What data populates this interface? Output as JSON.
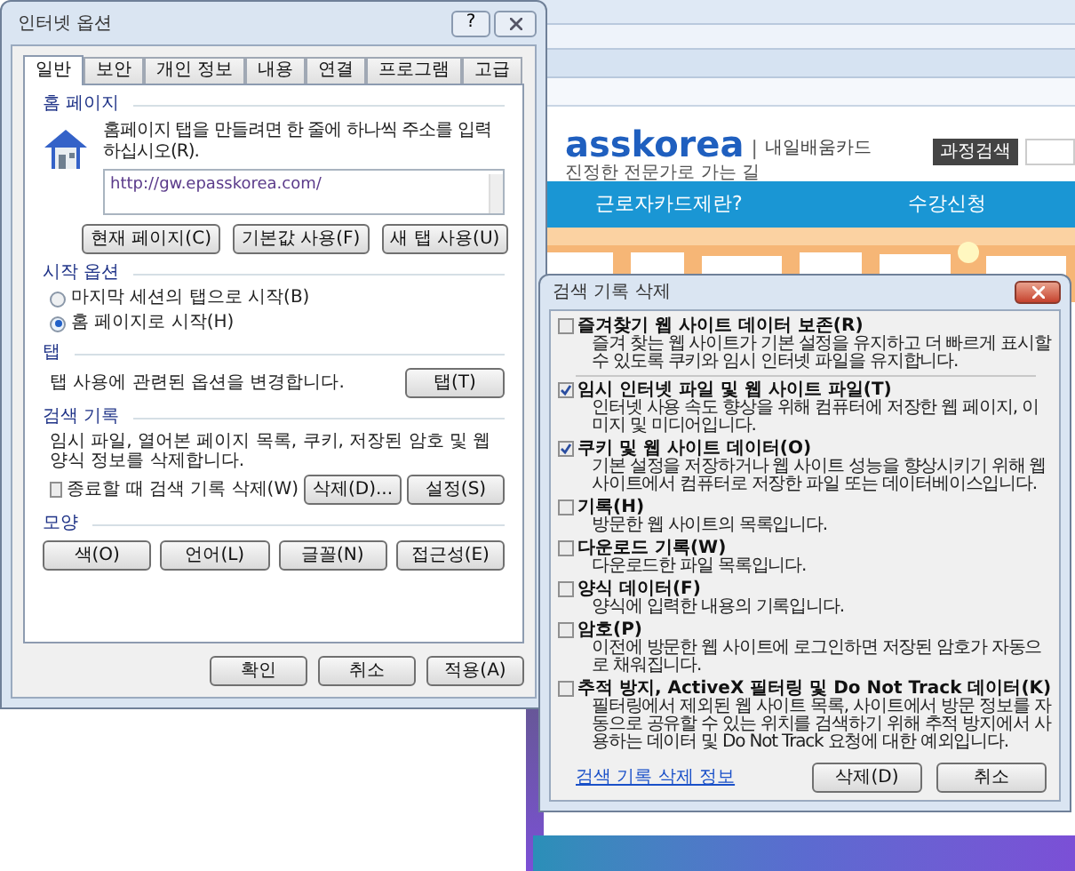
{
  "background_page": {
    "logo": "asskorea",
    "logo_divider": "|",
    "logo_caption": "내일배움카드",
    "tagline": "진정한 전문가로 가는 길",
    "search_button": "과정검색",
    "nav": [
      "근로자카드제란?",
      "수강신청"
    ],
    "banner": {
      "kind": "picture"
    }
  },
  "internet_options": {
    "title": "인터넷 옵션",
    "help_button": "?",
    "tabs": [
      {
        "label": "일반",
        "selected": true
      },
      {
        "label": "보안",
        "selected": false
      },
      {
        "label": "개인 정보",
        "selected": false
      },
      {
        "label": "내용",
        "selected": false
      },
      {
        "label": "연결",
        "selected": false
      },
      {
        "label": "프로그램",
        "selected": false
      },
      {
        "label": "고급",
        "selected": false
      }
    ],
    "home_page": {
      "heading": "홈 페이지",
      "description": "홈페이지 탭을 만들려면 한 줄에 하나씩 주소를 입력하십시오(R).",
      "url": "http://gw.epasskorea.com/",
      "buttons": [
        "현재 페이지(C)",
        "기본값 사용(F)",
        "새 탭 사용(U)"
      ]
    },
    "startup": {
      "heading": "시작 옵션",
      "options": [
        {
          "label": "마지막 세션의 탭으로 시작(B)",
          "selected": false
        },
        {
          "label": "홈 페이지로 시작(H)",
          "selected": true
        }
      ]
    },
    "tabs_section": {
      "heading": "탭",
      "description": "탭 사용에 관련된 옵션을 변경합니다.",
      "button": "탭(T)"
    },
    "history": {
      "heading": "검색 기록",
      "description": "임시 파일, 열어본 페이지 목록, 쿠키, 저장된 암호 및 웹 양식 정보를 삭제합니다.",
      "delete_on_exit": {
        "label": "종료할 때 검색 기록 삭제(W)",
        "checked": false
      },
      "buttons": [
        "삭제(D)...",
        "설정(S)"
      ]
    },
    "appearance": {
      "heading": "모양",
      "buttons": [
        "색(O)",
        "언어(L)",
        "글꼴(N)",
        "접근성(E)"
      ]
    },
    "footer_buttons": [
      "확인",
      "취소",
      "적용(A)"
    ]
  },
  "delete_history": {
    "title": "검색 기록 삭제",
    "items": [
      {
        "label": "즐겨찾기 웹 사이트 데이터 보존(R)",
        "description": "즐겨 찾는 웹 사이트가 기본 설정을 유지하고 더 빠르게 표시할 수 있도록 쿠키와 임시 인터넷 파일을 유지합니다.",
        "checked": false
      },
      {
        "label": "임시 인터넷 파일 및 웹 사이트 파일(T)",
        "description": "인터넷 사용 속도 향상을 위해 컴퓨터에 저장한 웹 페이지, 이미지 및 미디어입니다.",
        "checked": true
      },
      {
        "label": "쿠키 및 웹 사이트 데이터(O)",
        "description": "기본 설정을 저장하거나 웹 사이트 성능을 향상시키기 위해 웹 사이트에서 컴퓨터로 저장한 파일 또는 데이터베이스입니다.",
        "checked": true
      },
      {
        "label": "기록(H)",
        "description": "방문한 웹 사이트의 목록입니다.",
        "checked": false
      },
      {
        "label": "다운로드 기록(W)",
        "description": "다운로드한 파일 목록입니다.",
        "checked": false
      },
      {
        "label": "양식 데이터(F)",
        "description": "양식에 입력한 내용의 기록입니다.",
        "checked": false
      },
      {
        "label": "암호(P)",
        "description": "이전에 방문한 웹 사이트에 로그인하면 저장된 암호가 자동으로 채워집니다.",
        "checked": false
      },
      {
        "label": "추적 방지, ActiveX 필터링 및 Do Not Track 데이터(K)",
        "description": "필터링에서 제외된 웹 사이트 목록, 사이트에서 방문 정보를 자동으로 공유할 수 있는 위치를 검색하기 위해 추적 방지에서 사용하는 데이터 및 Do Not Track 요청에 대한 예외입니다.",
        "checked": false
      }
    ],
    "link": "검색 기록 삭제 정보",
    "buttons": [
      "삭제(D)",
      "취소"
    ]
  }
}
